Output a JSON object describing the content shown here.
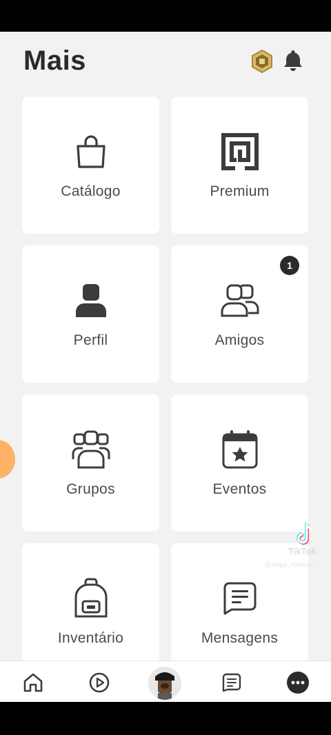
{
  "header": {
    "title": "Mais",
    "robux_icon": "robux-icon",
    "notification_icon": "bell-icon"
  },
  "menu": {
    "items": [
      {
        "label": "Catálogo",
        "icon": "shopping-bag-icon"
      },
      {
        "label": "Premium",
        "icon": "premium-icon"
      },
      {
        "label": "Perfil",
        "icon": "profile-icon"
      },
      {
        "label": "Amigos",
        "icon": "friends-icon",
        "badge": "1"
      },
      {
        "label": "Grupos",
        "icon": "groups-icon"
      },
      {
        "label": "Eventos",
        "icon": "calendar-star-icon"
      },
      {
        "label": "Inventário",
        "icon": "backpack-icon"
      },
      {
        "label": "Mensagens",
        "icon": "messages-icon"
      }
    ]
  },
  "watermark": {
    "brand": "TikTok",
    "handle": "@mtpo_robloxx"
  },
  "navbar": {
    "items": [
      "home-icon",
      "play-icon",
      "avatar",
      "chat-icon",
      "more-icon"
    ]
  },
  "colors": {
    "background": "#f2f2f3",
    "card": "#ffffff",
    "text": "#4a4a4c",
    "icon": "#3c3c3e",
    "badge": "#2b2b2d",
    "robux_gold": "#c9a24a"
  }
}
